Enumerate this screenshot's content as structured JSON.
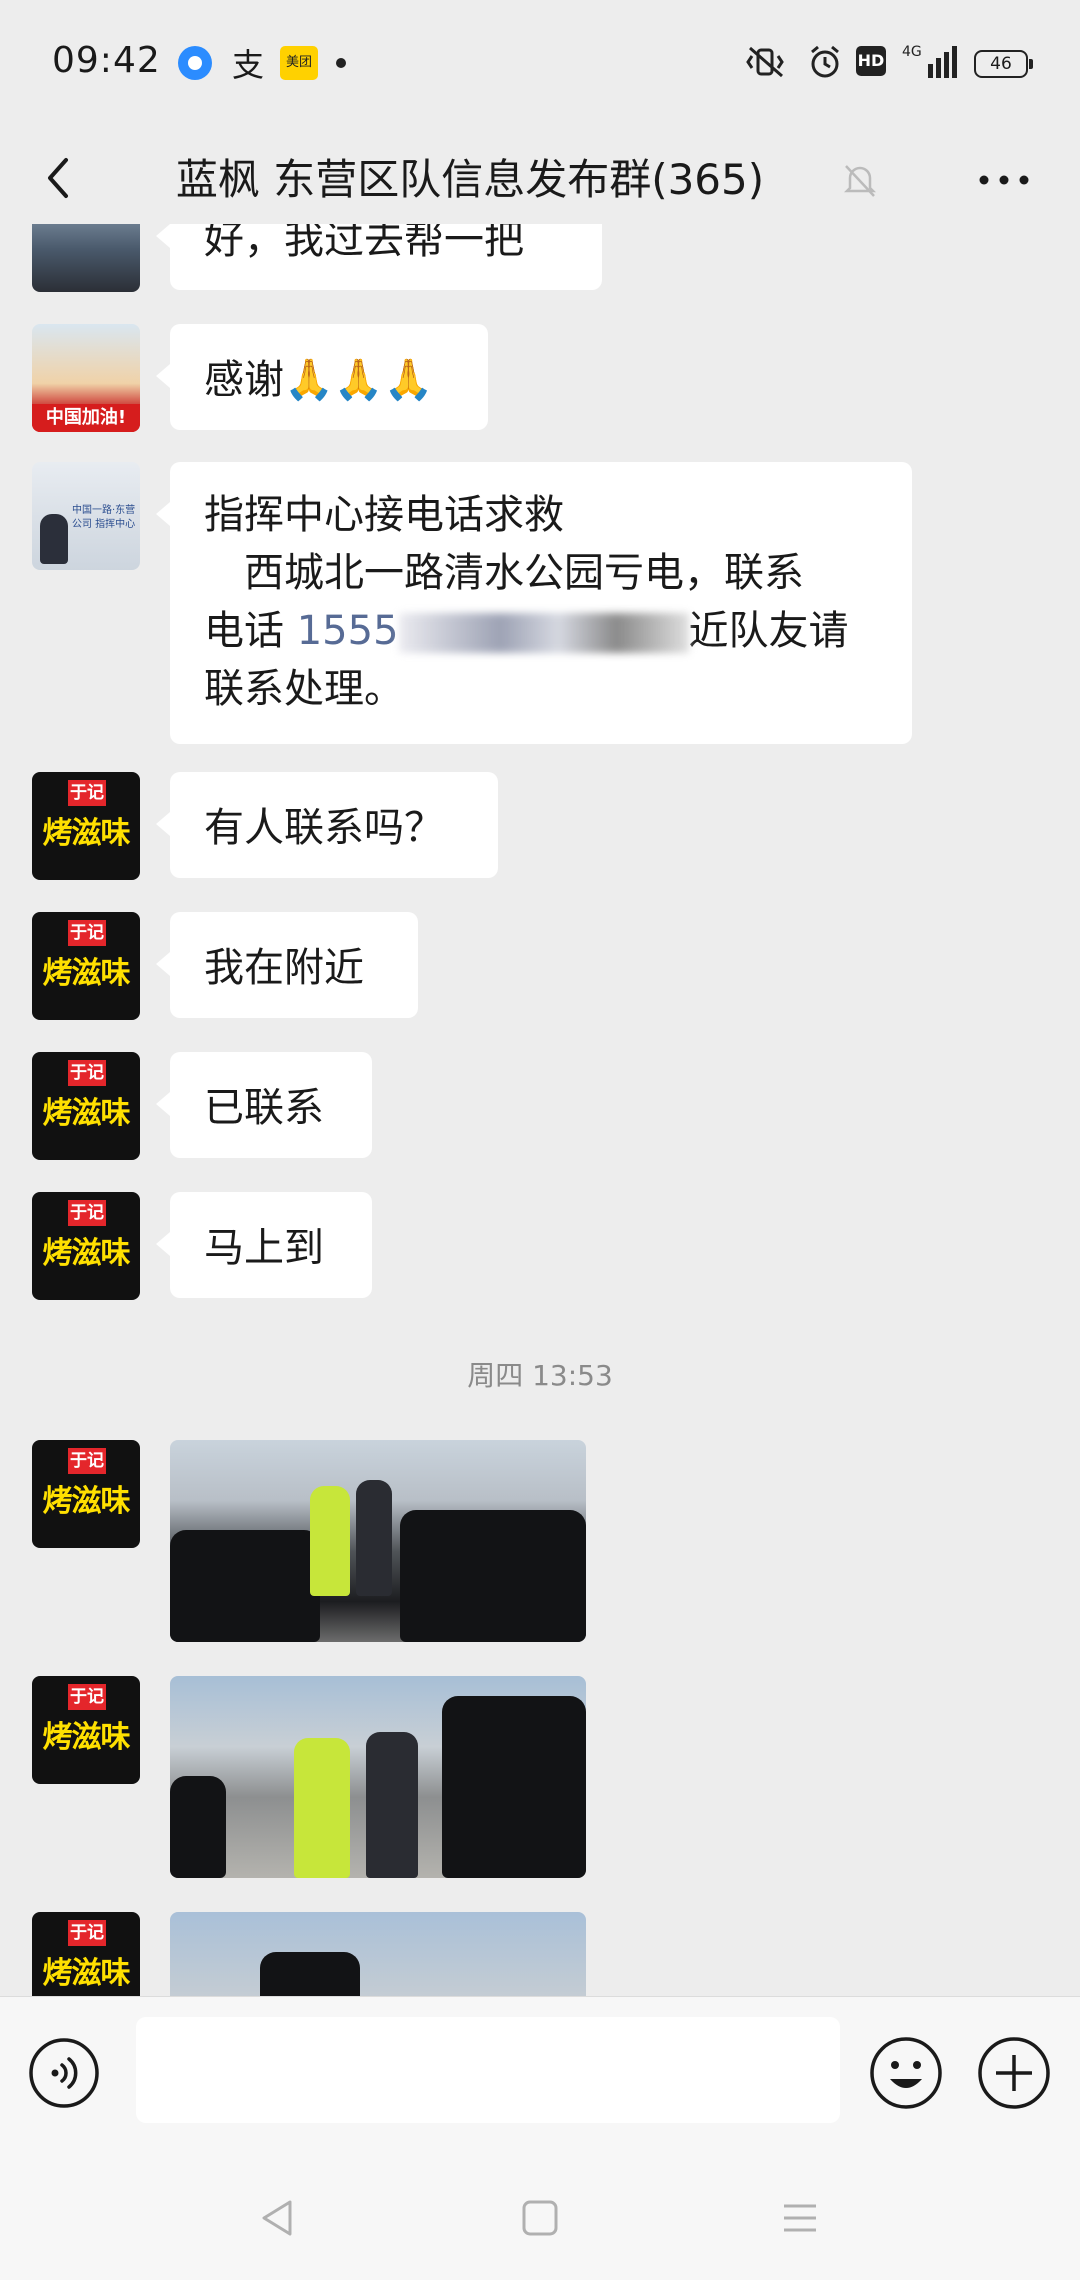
{
  "status_bar": {
    "time": "09:42",
    "app_icons": [
      "qq-browser-icon",
      "alipay-icon",
      "meituan-icon",
      "notification-dot"
    ],
    "meituan_label": "美团",
    "alipay_glyph": "支",
    "hd_label": "HD",
    "network": "4G",
    "battery": "46"
  },
  "title_bar": {
    "title": "蓝枫 东营区队信息发布群(365)",
    "muted": true
  },
  "messages": [
    {
      "type": "text",
      "avatar": "road",
      "text": "好，我过去帮一把"
    },
    {
      "type": "text",
      "avatar": "china-fan",
      "avatar_label": "中国加油!",
      "text": "感谢🙏🙏🙏"
    },
    {
      "type": "text",
      "avatar": "office",
      "avatar_label": "中国一路·东营公司 指挥中心",
      "line1": "指挥中心接电话求救",
      "line2": "　西城北一路清水公园亏电，联系",
      "line3_prefix": "电话 ",
      "phone": "1555",
      "line3_suffix": "近队友请",
      "line4": "联系处理。"
    },
    {
      "type": "text",
      "avatar": "shop",
      "text": "有人联系吗？"
    },
    {
      "type": "text",
      "avatar": "shop",
      "text": "我在附近"
    },
    {
      "type": "text",
      "avatar": "shop",
      "text": "已联系"
    },
    {
      "type": "text",
      "avatar": "shop",
      "text": "马上到"
    },
    {
      "type": "timestamp",
      "text": "周四 13:53"
    },
    {
      "type": "image",
      "avatar": "shop",
      "desc": "jump-start-photo-1"
    },
    {
      "type": "image",
      "avatar": "shop",
      "desc": "jump-start-photo-2"
    },
    {
      "type": "image",
      "avatar": "shop",
      "desc": "jump-start-photo-3"
    }
  ],
  "shop_avatar": {
    "badge": "于记",
    "name": "烤滋味"
  },
  "input_bar": {
    "placeholder": ""
  },
  "colors": {
    "background": "#ededed",
    "bubble": "#ffffff",
    "link": "#576b95"
  }
}
